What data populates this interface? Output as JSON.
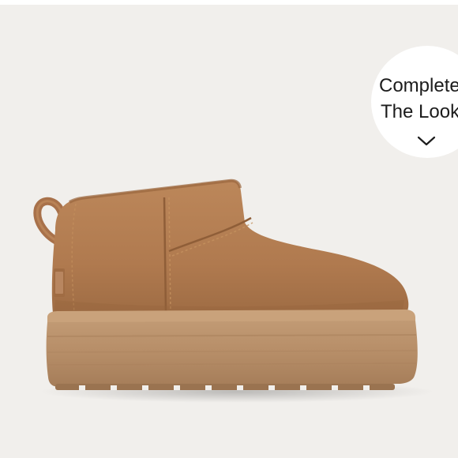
{
  "colors": {
    "background": "#f1efec",
    "suede": "#b07a4f",
    "suede_dark": "#8f5e38",
    "suede_light": "#c08a5c",
    "sole": "#b78e69",
    "sole_dark": "#9c7452",
    "badge_bg": "#ffffff",
    "badge_text": "#1c1c1c"
  },
  "product_image": {
    "icon": "ugg-platform-mini-boot-image"
  },
  "complete_the_look": {
    "line1": "Complete",
    "line2": "The Look",
    "icon": "chevron-down-icon"
  }
}
